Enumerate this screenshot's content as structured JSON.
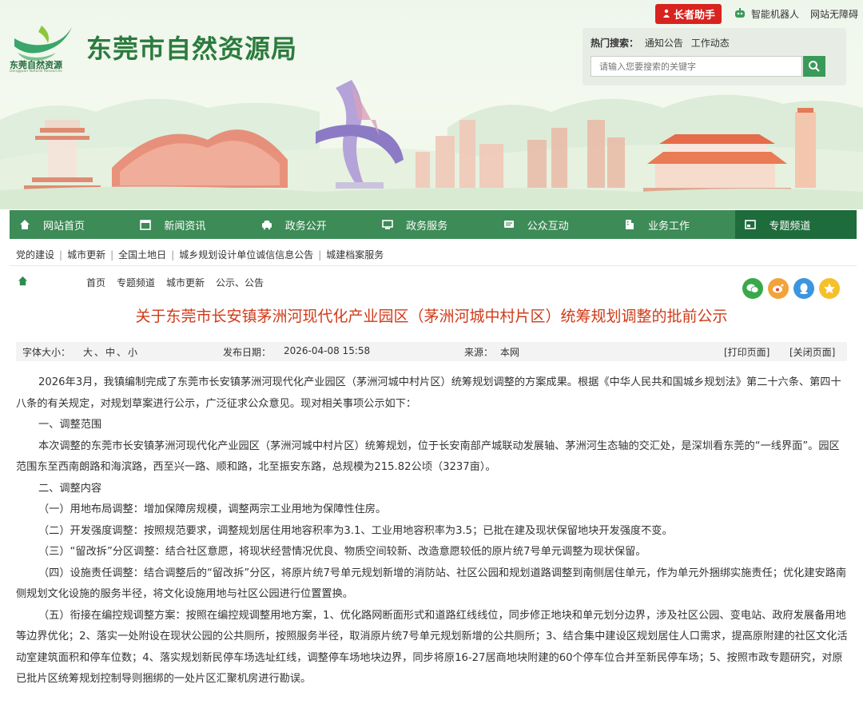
{
  "header": {
    "logo_cn": "东莞自然资源",
    "logo_en": "Dongguan Natural Resources",
    "site_title": "东莞市自然资源局",
    "top_links": {
      "elder": "长者助手",
      "robot": "智能机器人",
      "accessibility": "网站无障碍"
    }
  },
  "search": {
    "hot_label": "热门搜索：",
    "hot_items": [
      "通知公告",
      "工作动态"
    ],
    "placeholder": "请输入您要搜索的关键字"
  },
  "nav": {
    "items": [
      {
        "label": "网站首页",
        "icon": "home-icon"
      },
      {
        "label": "新闻资讯",
        "icon": "calendar-icon"
      },
      {
        "label": "政务公开",
        "icon": "car-icon"
      },
      {
        "label": "政务服务",
        "icon": "monitor-icon"
      },
      {
        "label": "公众互动",
        "icon": "chat-icon"
      },
      {
        "label": "业务工作",
        "icon": "building-icon"
      },
      {
        "label": "专题频道",
        "icon": "window-icon",
        "active": true
      }
    ]
  },
  "subnav": {
    "items": [
      "党的建设",
      "城市更新",
      "全国土地日",
      "城乡规划设计单位诚信信息公告",
      "城建档案服务"
    ]
  },
  "breadcrumb": {
    "items": [
      "首页",
      "专题频道",
      "城市更新",
      "公示、公告"
    ]
  },
  "share_icons": [
    "wechat-icon",
    "weibo-icon",
    "qq-icon",
    "favorite-icon"
  ],
  "colors": {
    "nav_bg": "#3d8b57",
    "nav_active": "#1e6b3c",
    "title_red": "#d03a18",
    "elder_red": "#d8231f"
  },
  "article": {
    "title": "关于东莞市长安镇茅洲河现代化产业园区（茅洲河城中村片区）统筹规划调整的批前公示",
    "meta": {
      "font_size_label": "字体大小：",
      "font_sizes": "大、中、小",
      "date_label": "发布日期：",
      "date": "2026-04-08 15:58",
      "source_label": "来源：",
      "source": "本网",
      "print": "[打印页面]",
      "close": "[关闭页面]"
    },
    "paragraphs": [
      "2026年3月，我镇编制完成了东莞市长安镇茅洲河现代化产业园区（茅洲河城中村片区）统筹规划调整的方案成果。根据《中华人民共和国城乡规划法》第二十六条、第四十八条的有关规定，对规划草案进行公示，广泛征求公众意见。现对相关事项公示如下：",
      "一、调整范围",
      "本次调整的东莞市长安镇茅洲河现代化产业园区（茅洲河城中村片区）统筹规划，位于长安南部产城联动发展轴、茅洲河生态轴的交汇处，是深圳看东莞的“一线界面”。园区范围东至西南朗路和海滨路，西至兴一路、顺和路，北至振安东路，总规模为215.82公顷（3237亩）。",
      "二、调整内容",
      "（一）用地布局调整：增加保障房规模，调整两宗工业用地为保障性住房。",
      "（二）开发强度调整：按照规范要求，调整规划居住用地容积率为3.1、工业用地容积率为3.5；已批在建及现状保留地块开发强度不变。",
      "（三）“留改拆”分区调整：结合社区意愿，将现状经营情况优良、物质空间较新、改造意愿较低的原片统7号单元调整为现状保留。",
      "（四）设施责任调整：结合调整后的“留改拆”分区，将原片统7号单元规划新增的消防站、社区公园和规划道路调整到南侧居住单元，作为单元外捆绑实施责任；优化建安路南侧规划文化设施的服务半径，将文化设施用地与社区公园进行位置置换。",
      "（五）衔接在编控规调整方案：按照在编控规调整用地方案，1、优化路网断面形式和道路红线线位，同步修正地块和单元划分边界，涉及社区公园、变电站、政府发展备用地等边界优化；2、落实一处附设在现状公园的公共厕所，按照服务半径，取消原片统7号单元规划新增的公共厕所；3、结合集中建设区规划居住人口需求，提高原附建的社区文化活动室建筑面积和停车位数；4、落实规划新民停车场选址红线，调整停车场地块边界，同步将原16-27居商地块附建的60个停车位合并至新民停车场；5、按照市政专题研究，对原已批片区统筹规划控制导则捆绑的一处片区汇聚机房进行勘误。"
    ]
  }
}
